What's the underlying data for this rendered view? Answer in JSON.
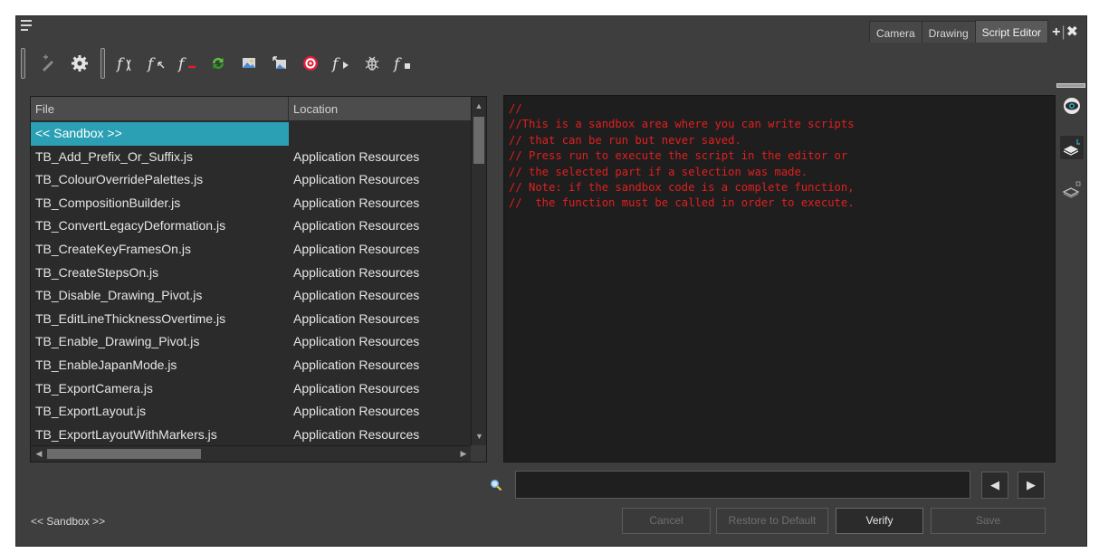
{
  "tabs": [
    {
      "label": "Camera",
      "active": false
    },
    {
      "label": "Drawing",
      "active": false
    },
    {
      "label": "Script Editor",
      "active": true
    }
  ],
  "tab_actions": {
    "add": "+",
    "separator": "|",
    "close": "✖"
  },
  "toolbar": {
    "icons": [
      "new-script-icon",
      "settings-gear-icon",
      "function-target-icon",
      "find-function-icon",
      "delete-function-icon",
      "refresh-icon",
      "import-icon",
      "export-icon",
      "target-icon",
      "run-function-icon",
      "debug-bug-icon",
      "stop-function-icon"
    ]
  },
  "file_table": {
    "columns": [
      "File",
      "Location"
    ],
    "rows": [
      {
        "file": "<< Sandbox >>",
        "location": "",
        "selected": true
      },
      {
        "file": "TB_Add_Prefix_Or_Suffix.js",
        "location": "Application Resources"
      },
      {
        "file": "TB_ColourOverridePalettes.js",
        "location": "Application Resources"
      },
      {
        "file": "TB_CompositionBuilder.js",
        "location": "Application Resources"
      },
      {
        "file": "TB_ConvertLegacyDeformation.js",
        "location": "Application Resources"
      },
      {
        "file": "TB_CreateKeyFramesOn.js",
        "location": "Application Resources"
      },
      {
        "file": "TB_CreateStepsOn.js",
        "location": "Application Resources"
      },
      {
        "file": "TB_Disable_Drawing_Pivot.js",
        "location": "Application Resources"
      },
      {
        "file": "TB_EditLineThicknessOvertime.js",
        "location": "Application Resources"
      },
      {
        "file": "TB_Enable_Drawing_Pivot.js",
        "location": "Application Resources"
      },
      {
        "file": "TB_EnableJapanMode.js",
        "location": "Application Resources"
      },
      {
        "file": "TB_ExportCamera.js",
        "location": "Application Resources"
      },
      {
        "file": "TB_ExportLayout.js",
        "location": "Application Resources"
      },
      {
        "file": "TB_ExportLayoutWithMarkers.js",
        "location": "Application Resources"
      }
    ]
  },
  "editor": {
    "lines": [
      "//",
      "//This is a sandbox area where you can write scripts",
      "// that can be run but never saved.",
      "// Press run to execute the script in the editor or",
      "// the selected part if a selection was made.",
      "// Note: if the sandbox code is a complete function,",
      "//  the function must be called in order to execute."
    ],
    "text_color": "#e21f1f"
  },
  "side_icons": [
    "eye-icon",
    "layer-light-table-icon",
    "layer-icon"
  ],
  "search": {
    "value": "",
    "placeholder": ""
  },
  "nav": {
    "prev": "◀",
    "next": "▶"
  },
  "footer": {
    "current_script": "<< Sandbox >>",
    "buttons": {
      "cancel": "Cancel",
      "restore": "Restore to Default",
      "verify": "Verify",
      "save": "Save"
    }
  },
  "colors": {
    "selection": "#2ba0b5",
    "panel": "#3e3e3e",
    "editor_bg": "#1e1e1e"
  }
}
